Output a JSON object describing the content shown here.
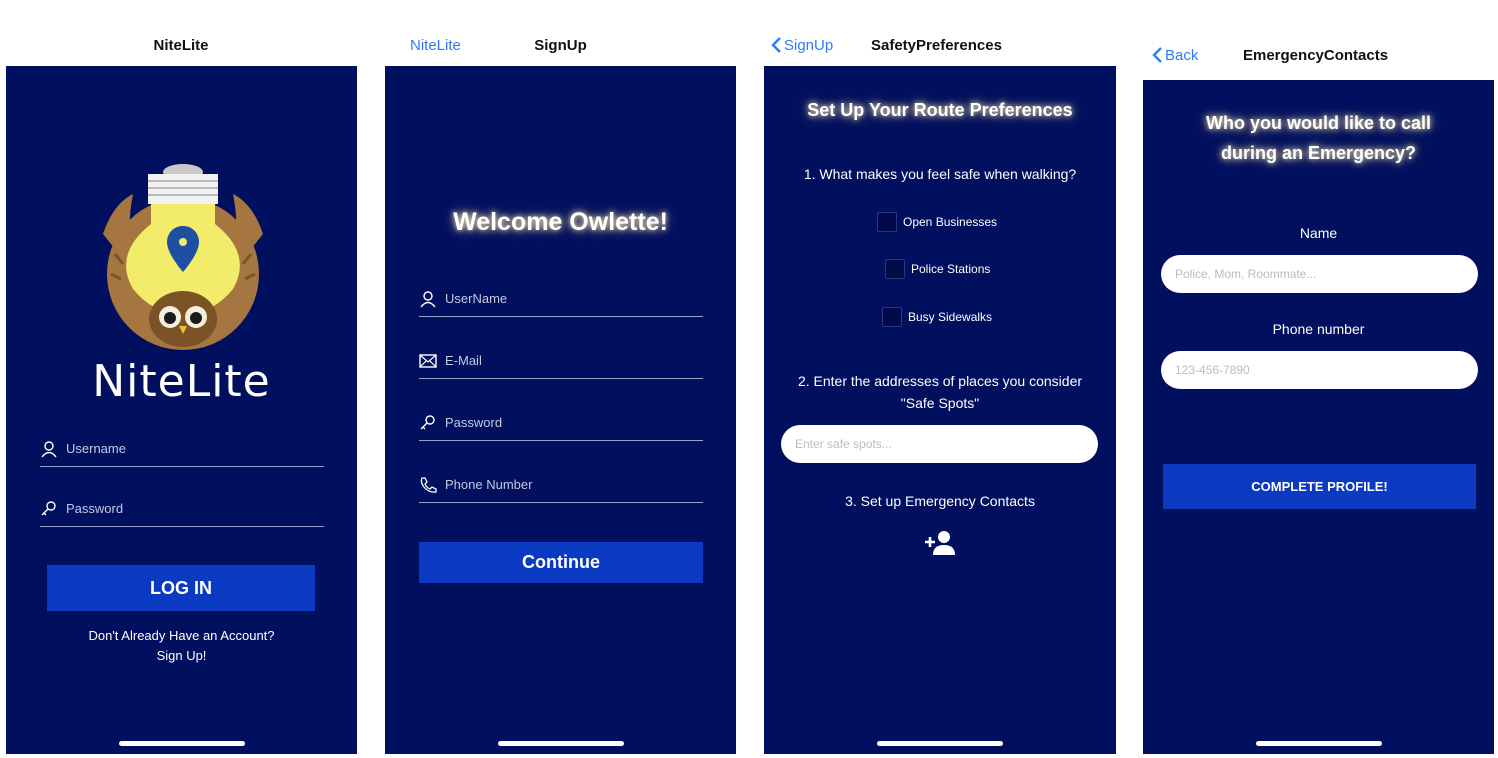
{
  "screen1": {
    "nav_title": "NiteLite",
    "app_name": "NiteLite",
    "username_placeholder": "Username",
    "password_placeholder": "Password",
    "login_label": "LOG IN",
    "signup_line1": "Don't Already Have an Account?",
    "signup_line2": "Sign Up!"
  },
  "screen2": {
    "back_label": "NiteLite",
    "nav_title": "SignUp",
    "welcome": "Welcome Owlette!",
    "username_placeholder": "UserName",
    "email_placeholder": "E-Mail",
    "password_placeholder": "Password",
    "phone_placeholder": "Phone Number",
    "continue_label": "Continue"
  },
  "screen3": {
    "back_label": "SignUp",
    "nav_title": "SafetyPreferences",
    "heading": "Set Up Your Route Preferences",
    "q1": "1. What makes you feel safe when walking?",
    "options": [
      "Open Businesses",
      "Police Stations",
      "Busy Sidewalks"
    ],
    "q2_line1": "2. Enter the addresses of places you consider",
    "q2_line2": "\"Safe Spots\"",
    "safe_spots_placeholder": "Enter safe spots...",
    "q3": "3. Set up Emergency Contacts"
  },
  "screen4": {
    "back_label": "Back",
    "nav_title": "EmergencyContacts",
    "heading_line1": "Who you would like to call",
    "heading_line2": "during an Emergency?",
    "name_label": "Name",
    "name_placeholder": "Police, Mom, Roommate...",
    "phone_label": "Phone number",
    "phone_placeholder": "123-456-7890",
    "complete_label": "COMPLETE PROFILE!"
  },
  "colors": {
    "screen_bg": "#000f5e",
    "button_blue": "#0a3ac1",
    "link_blue": "#2f7cf6",
    "bulb_yellow": "#f3ec6a",
    "owl_brown": "#a5763f"
  }
}
